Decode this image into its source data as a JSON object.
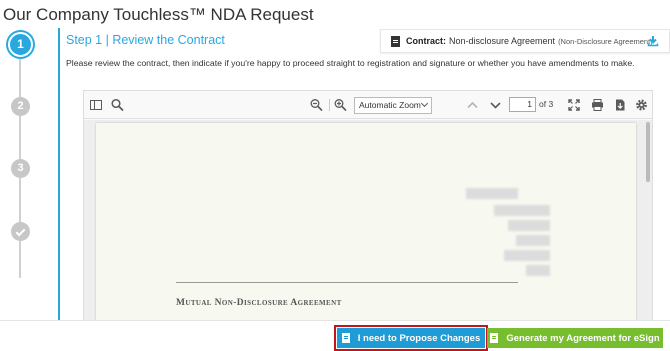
{
  "page": {
    "title": "Our Company Touchless™ NDA Request"
  },
  "stepper": {
    "steps": [
      {
        "label": "1",
        "state": "active"
      },
      {
        "label": "2",
        "state": "inactive"
      },
      {
        "label": "3",
        "state": "inactive"
      },
      {
        "label": "",
        "state": "done",
        "icon": "check-icon"
      }
    ]
  },
  "step": {
    "heading": "Step 1 | Review the Contract"
  },
  "contract": {
    "label": "Contract:",
    "name": "Non-disclosure Agreement",
    "subtitle": "(Non-Disclosure Agreement)",
    "icon": "document-icon",
    "download_icon": "download-icon"
  },
  "instructions": "Please review the contract, then indicate if you're happy to proceed straight to registration and signature or whether you have amendments to make.",
  "viewer": {
    "zoom": "Automatic Zoom",
    "page_current": "1",
    "page_total": "of 3",
    "pdf_heading": "Mutual Non-Disclosure Agreement"
  },
  "footer": {
    "propose_label": "I need to Propose Changes",
    "generate_label": "Generate my Agreement for eSign"
  },
  "colors": {
    "accent": "#29a8e0",
    "propose_button": "#1f9bd6",
    "generate_button": "#77be2e",
    "highlight": "#c0161c"
  }
}
